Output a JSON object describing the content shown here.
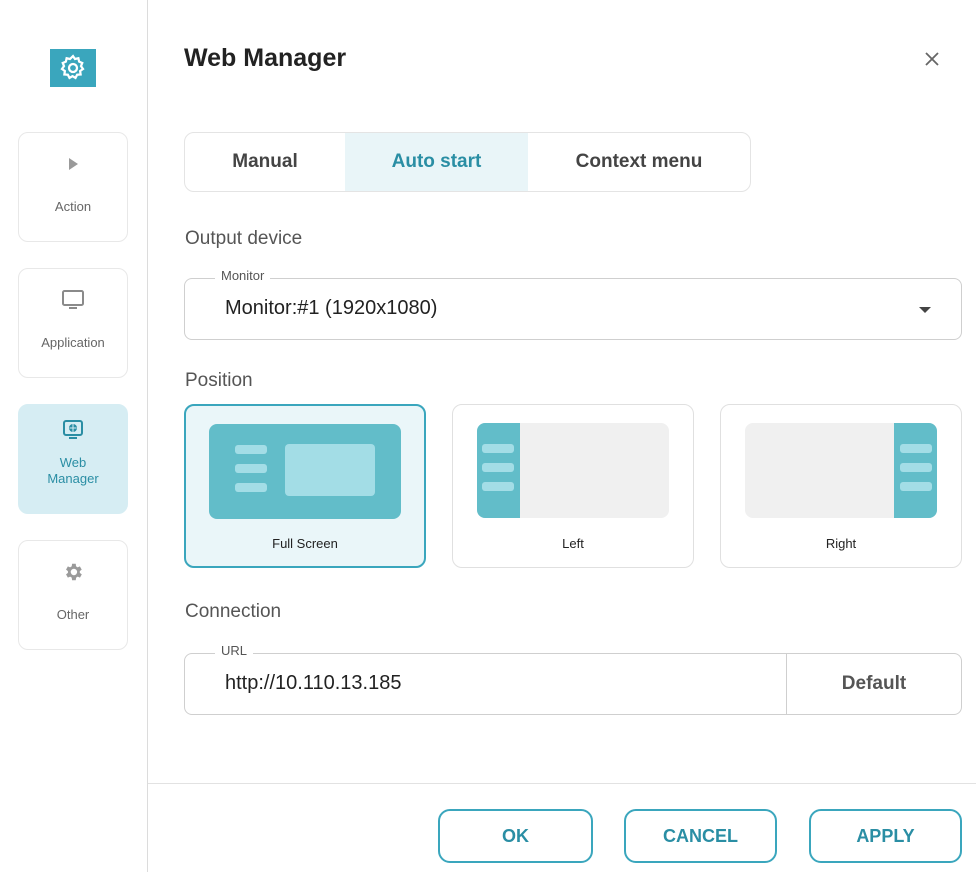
{
  "sidebar": {
    "items": [
      {
        "label": "Action",
        "icon": "play-icon"
      },
      {
        "label": "Application",
        "icon": "monitor-icon"
      },
      {
        "label": "Web\nManager",
        "icon": "web-manager-icon"
      },
      {
        "label": "Other",
        "icon": "gear-icon"
      }
    ],
    "active_index": 2
  },
  "dialog": {
    "title": "Web Manager",
    "close_icon": "close-icon"
  },
  "tabs": [
    {
      "label": "Manual",
      "active": false
    },
    {
      "label": "Auto start",
      "active": true
    },
    {
      "label": "Context menu",
      "active": false
    }
  ],
  "output_device": {
    "section_label": "Output device",
    "legend": "Monitor",
    "value": "Monitor:#1 (1920x1080)"
  },
  "position": {
    "section_label": "Position",
    "options": [
      {
        "label": "Full Screen",
        "selected": true
      },
      {
        "label": "Left",
        "selected": false
      },
      {
        "label": "Right",
        "selected": false
      }
    ]
  },
  "connection": {
    "section_label": "Connection",
    "legend": "URL",
    "value": "http://10.110.13.185",
    "default_label": "Default"
  },
  "buttons": {
    "ok": "OK",
    "cancel": "CANCEL",
    "apply": "APPLY"
  },
  "colors": {
    "accent": "#3aa6bd",
    "accent_text": "#2a8ea4",
    "active_bg": "#d6edf3",
    "preview_fill": "#62bdc9",
    "preview_bar": "#a3dde6"
  }
}
